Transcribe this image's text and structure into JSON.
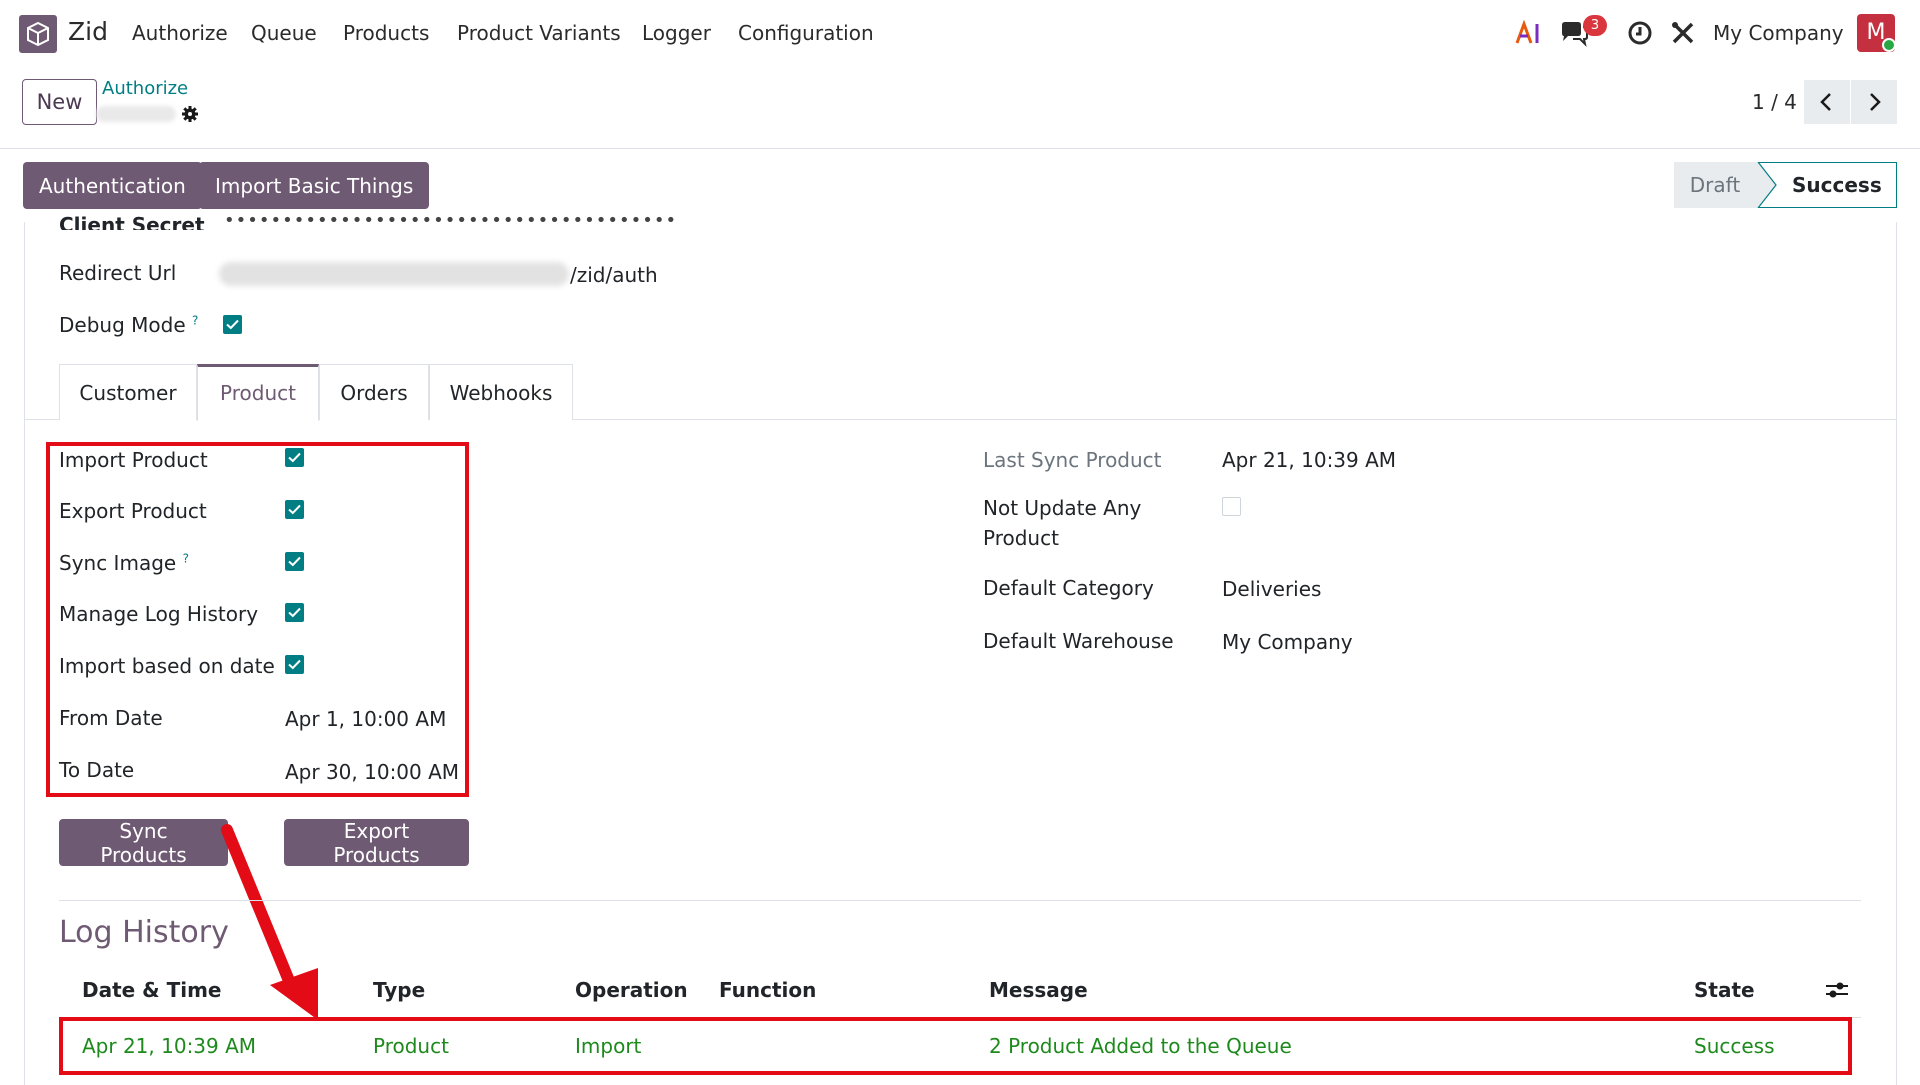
{
  "navbar": {
    "app_name": "Zid",
    "menus": [
      "Authorize",
      "Queue",
      "Products",
      "Product Variants",
      "Logger",
      "Configuration"
    ],
    "icons": [
      "ai-icon",
      "chat-icon",
      "clock-icon",
      "tools-icon"
    ],
    "chat_badge": "3",
    "company": "My Company",
    "avatar_letter": "M"
  },
  "control": {
    "new_label": "New",
    "breadcrumb": "Authorize",
    "pager": "1 / 4"
  },
  "statusbar": {
    "buttons": [
      "Authentication",
      "Import Basic Things"
    ],
    "stages": [
      "Draft",
      "Success"
    ],
    "active_stage": "Success"
  },
  "form": {
    "client_secret_label": "Client Secret",
    "client_secret_value": "•••••••••••••••••••••••••••••••••••••••",
    "redirect_url_label": "Redirect Url",
    "redirect_url_suffix": "/zid/auth",
    "debug_mode_label": "Debug Mode",
    "help_mark": "?"
  },
  "tabs": [
    "Customer",
    "Product",
    "Orders",
    "Webhooks"
  ],
  "active_tab": "Product",
  "product": {
    "left": {
      "import_product": "Import Product",
      "export_product": "Export Product",
      "sync_image": "Sync Image",
      "manage_log_history": "Manage Log History",
      "import_based_on_date": "Import based on date",
      "from_date_label": "From Date",
      "from_date_value": "Apr 1, 10:00 AM",
      "to_date_label": "To Date",
      "to_date_value": "Apr 30, 10:00 AM"
    },
    "right": {
      "last_sync_label": "Last Sync Product",
      "last_sync_value": "Apr 21, 10:39 AM",
      "not_update_label_1": "Not Update Any",
      "not_update_label_2": "Product",
      "default_category_label": "Default Category",
      "default_category_value": "Deliveries",
      "default_warehouse_label": "Default Warehouse",
      "default_warehouse_value": "My Company"
    },
    "buttons": {
      "sync": "Sync Products",
      "export": "Export Products"
    }
  },
  "log_history": {
    "title": "Log History",
    "columns": [
      "Date & Time",
      "Type",
      "Operation",
      "Function",
      "Message",
      "State"
    ],
    "rows": [
      {
        "date": "Apr 21, 10:39 AM",
        "type": "Product",
        "operation": "Import",
        "function": "",
        "message": "2 Product Added to the Queue",
        "state": "Success"
      }
    ]
  },
  "colors": {
    "primary": "#6f5a74",
    "accent": "#017e84",
    "highlight": "#e30b16",
    "success_text": "#1e8a1e"
  }
}
